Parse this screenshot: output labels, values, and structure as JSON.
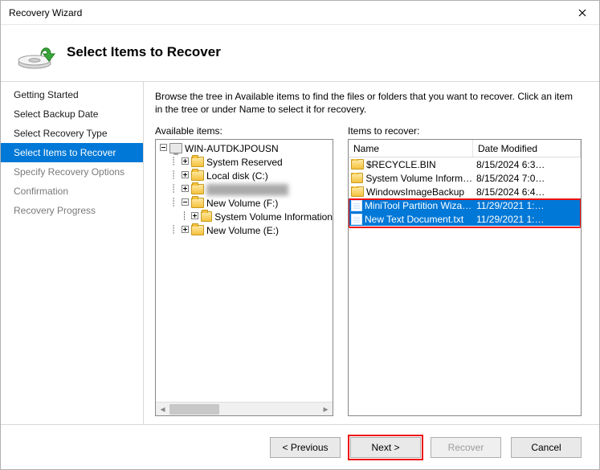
{
  "titlebar": {
    "title": "Recovery Wizard"
  },
  "header": {
    "title": "Select Items to Recover"
  },
  "sidebar": {
    "items": [
      {
        "label": "Getting Started",
        "state": "done"
      },
      {
        "label": "Select Backup Date",
        "state": "done"
      },
      {
        "label": "Select Recovery Type",
        "state": "done"
      },
      {
        "label": "Select Items to Recover",
        "state": "active"
      },
      {
        "label": "Specify Recovery Options",
        "state": "disabled"
      },
      {
        "label": "Confirmation",
        "state": "disabled"
      },
      {
        "label": "Recovery Progress",
        "state": "disabled"
      }
    ]
  },
  "main": {
    "instruction": "Browse the tree in Available items to find the files or folders that you want to recover. Click an item in the tree or under Name to select it for recovery.",
    "left_label": "Available items:",
    "right_label": "Items to recover:",
    "tree": {
      "root": "WIN-AUTDKJPOUSN",
      "nodes": [
        {
          "label": "System Reserved"
        },
        {
          "label": "Local disk (C:)"
        },
        {
          "label": "",
          "blurred": true
        },
        {
          "label": "New Volume (F:)",
          "expanded": true,
          "children": [
            {
              "label": "System Volume Information"
            }
          ]
        },
        {
          "label": "New Volume (E:)"
        }
      ]
    },
    "grid": {
      "columns": {
        "name": "Name",
        "date": "Date Modified"
      },
      "rows": [
        {
          "name": "$RECYCLE.BIN",
          "date": "8/15/2024 6:3…",
          "icon": "folder",
          "selected": false
        },
        {
          "name": "System Volume Informa…",
          "date": "8/15/2024 7:0…",
          "icon": "folder",
          "selected": false
        },
        {
          "name": "WindowsImageBackup",
          "date": "8/15/2024 6:4…",
          "icon": "folder",
          "selected": false
        },
        {
          "name": "MiniTool Partition Wizar…",
          "date": "11/29/2021 1:…",
          "icon": "file",
          "selected": true
        },
        {
          "name": "New Text Document.txt",
          "date": "11/29/2021 1:…",
          "icon": "file",
          "selected": true
        }
      ]
    }
  },
  "footer": {
    "previous": "< Previous",
    "next": "Next >",
    "recover": "Recover",
    "cancel": "Cancel"
  }
}
